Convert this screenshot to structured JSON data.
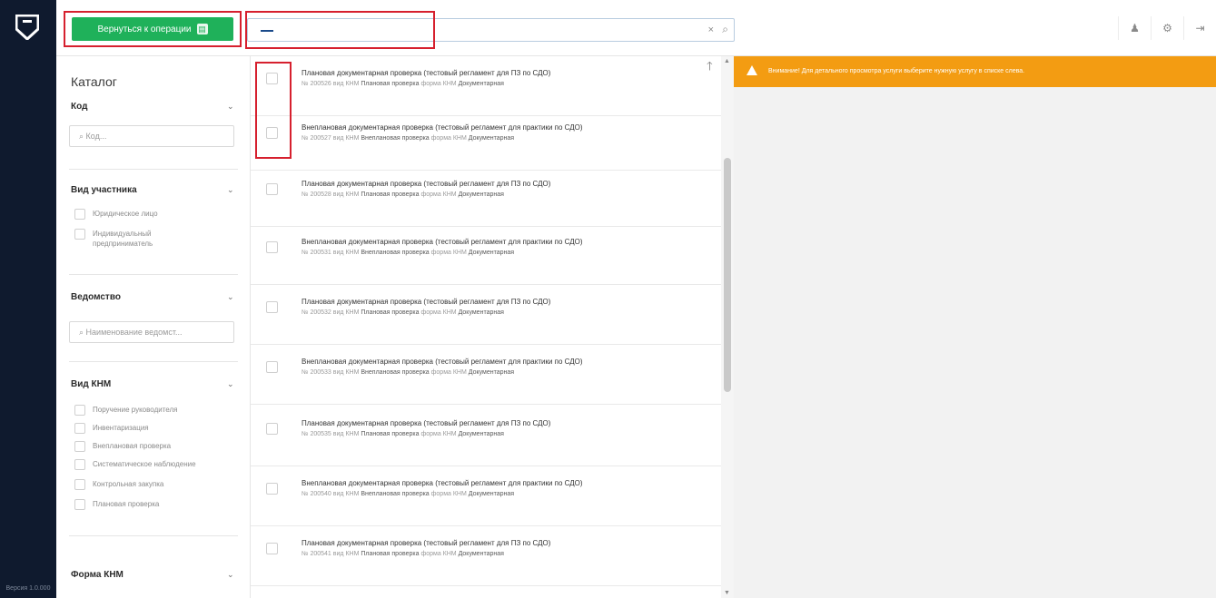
{
  "rail": {
    "version": "Версия 1.0.000"
  },
  "topbar": {
    "back_button": "Вернуться к операции",
    "back_icon": "doc-icon",
    "search": {
      "value": "",
      "clear": "×",
      "icon": "search-icon"
    },
    "icons": [
      "user-icon",
      "settings-icon",
      "logout-icon"
    ]
  },
  "catalog": {
    "title": "Каталог",
    "code": {
      "label": "Код",
      "placeholder": "Код..."
    },
    "participant": {
      "label": "Вид участника",
      "options": [
        "Юридическое лицо",
        "Индивидуальный",
        "предприниматель"
      ]
    },
    "agency": {
      "label": "Ведомство",
      "placeholder": "Наименование ведомст..."
    },
    "knm": {
      "label": "Вид КНМ",
      "options": [
        "Поручение руководителя",
        "Инвентаризация",
        "Внеплановая проверка",
        "Систематическое наблюдение",
        "Контрольная закупка",
        "Плановая проверка"
      ]
    },
    "form": {
      "label": "Форма КНМ"
    }
  },
  "list": {
    "meta_number_prefix": "№",
    "meta_kind_label": "вид КНМ",
    "meta_form_label": "форма КНМ",
    "items": [
      {
        "title": "Плановая документарная проверка (тестовый регламент для ПЗ по СДО)",
        "number": "200526",
        "kind": "Плановая проверка",
        "form": "Документарная"
      },
      {
        "title": "Внеплановая документарная проверка (тестовый регламент для практики по СДО)",
        "number": "200527",
        "kind": "Внеплановая проверка",
        "form": "Документарная"
      },
      {
        "title": "Плановая документарная проверка (тестовый регламент для ПЗ по СДО)",
        "number": "200528",
        "kind": "Плановая проверка",
        "form": "Документарная"
      },
      {
        "title": "Внеплановая документарная проверка (тестовый регламент для практики по СДО)",
        "number": "200531",
        "kind": "Внеплановая проверка",
        "form": "Документарная"
      },
      {
        "title": "Плановая документарная проверка (тестовый регламент для ПЗ по СДО)",
        "number": "200532",
        "kind": "Плановая проверка",
        "form": "Документарная"
      },
      {
        "title": "Внеплановая документарная проверка (тестовый регламент для практики по СДО)",
        "number": "200533",
        "kind": "Внеплановая проверка",
        "form": "Документарная"
      },
      {
        "title": "Плановая документарная проверка (тестовый регламент для ПЗ по СДО)",
        "number": "200535",
        "kind": "Плановая проверка",
        "form": "Документарная"
      },
      {
        "title": "Внеплановая документарная проверка (тестовый регламент для практики по СДО)",
        "number": "200540",
        "kind": "Внеплановая проверка",
        "form": "Документарная"
      },
      {
        "title": "Плановая документарная проверка (тестовый регламент для ПЗ по СДО)",
        "number": "200541",
        "kind": "Плановая проверка",
        "form": "Документарная"
      }
    ]
  },
  "right": {
    "warning": "Внимание! Для детального просмотра услуги выберите нужную услугу в списке слева."
  },
  "colors": {
    "rail": "#0f1a2e",
    "accent_green": "#1fb15a",
    "warning": "#f39c12",
    "highlight": "#d6202e"
  }
}
